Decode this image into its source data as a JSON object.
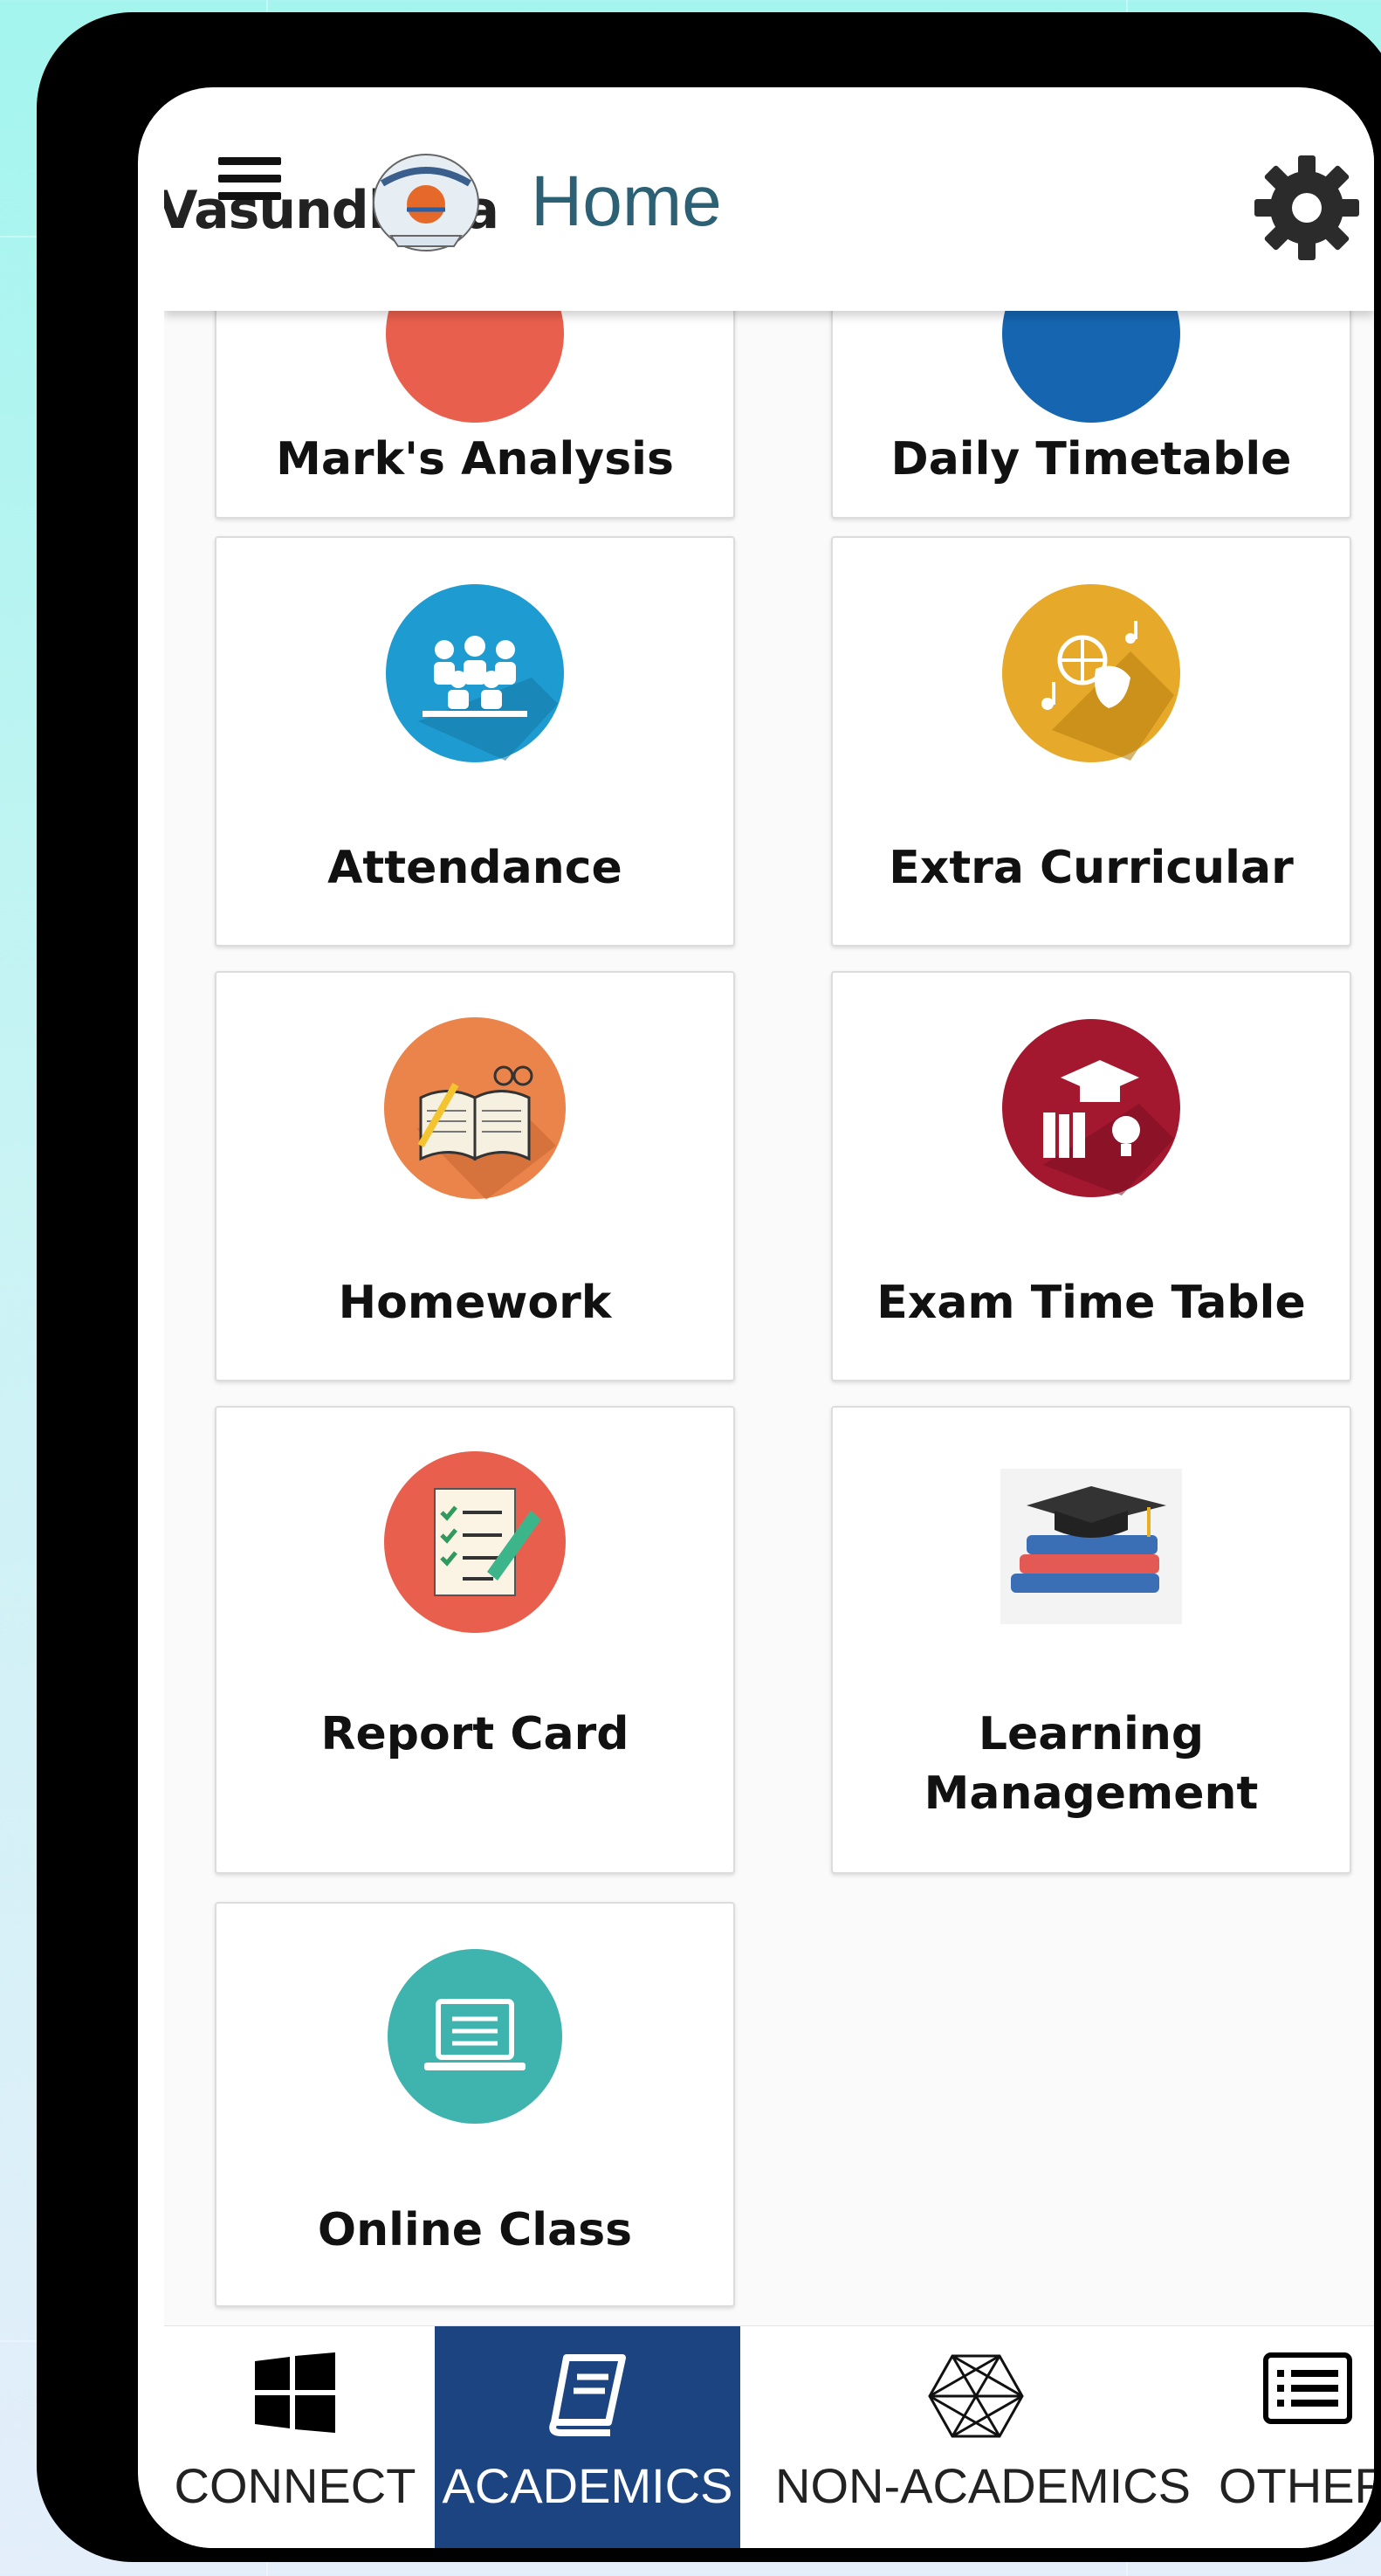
{
  "header": {
    "brand_text": "Vasundhara",
    "title": "Home",
    "menu_icon": "hamburger-menu-icon",
    "settings_icon": "gear-icon"
  },
  "tiles": [
    {
      "label": "Mark's Analysis",
      "icon": "marks-analysis-icon"
    },
    {
      "label": "Daily Timetable",
      "icon": "daily-timetable-icon"
    },
    {
      "label": "Attendance",
      "icon": "attendance-icon"
    },
    {
      "label": "Extra Curricular",
      "icon": "extra-curricular-icon"
    },
    {
      "label": "Homework",
      "icon": "homework-icon"
    },
    {
      "label": "Exam Time Table",
      "icon": "exam-time-table-icon"
    },
    {
      "label": "Report Card",
      "icon": "report-card-icon"
    },
    {
      "label_line1": "Learning",
      "label_line2": "Management",
      "icon": "learning-management-icon"
    },
    {
      "label": "Online Class",
      "icon": "online-class-icon"
    }
  ],
  "bottom_nav": [
    {
      "label": "CONNECT",
      "icon": "windows-icon",
      "active": false
    },
    {
      "label": "ACADEMICS",
      "icon": "book-icon",
      "active": true
    },
    {
      "label": "NON-ACADEMICS",
      "icon": "mesh-icon",
      "active": false
    },
    {
      "label": "OTHER",
      "icon": "list-icon",
      "active": false
    }
  ],
  "colors": {
    "header_title": "#2b6075",
    "nav_active_bg": "#1c4480",
    "attendance": "#1e9bd0",
    "extra_curricular": "#e6a92a",
    "homework": "#ea844a",
    "exam": "#a3182f",
    "report_card": "#e95f4d",
    "online_class": "#3fb3ad"
  }
}
